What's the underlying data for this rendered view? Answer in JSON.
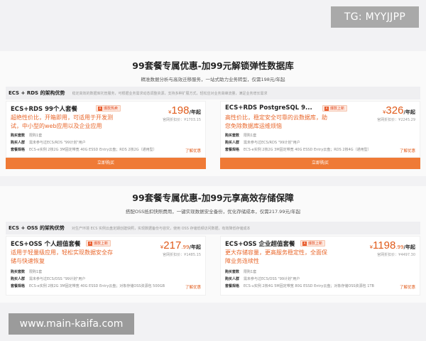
{
  "watermark_top": "TG: MYYJJPP",
  "watermark_bottom": "www.main-kaifa.com",
  "section1": {
    "headline": "99套餐专属优惠-加99元解锁弹性数据库",
    "subline": "精准数据分析与高效迁移服务，一站式助力业务转型，仅需198元/年起",
    "arch_title": "ECS + RDS 的架构优势",
    "arch_desc": "稳定高效的数据库托管服务，可根据业务需求动态调整资源，支持多种扩展方式，轻松应对业务高峰流量，满足业务增长需求",
    "cards": [
      {
        "name": "ECS+RDS 99个人套餐",
        "badge": "爆款热卖",
        "desc": "超绝性价比，开箱即用，可适用于开发测试，中小型的web应用以及企业应用",
        "price_symbol": "¥",
        "price": "198",
        "price_unit": "/年起",
        "orig_price": "官网折扣价：¥1703.15",
        "spec_rows": [
          {
            "label": "购买套数",
            "value": "限购1套"
          },
          {
            "label": "购买人群",
            "value": "需未参与过ECS/RDS \"99计划\"用户"
          },
          {
            "label": "套餐规格",
            "value": "ECS-e实例 2核2G 3M固定带宽 40G ESSD Entry云盘；RDS 2核2G（通用型）"
          }
        ],
        "more": "了解优惠",
        "buy": "立即购买"
      },
      {
        "name": "ECS+RDS PostgreSQL 9...",
        "badge": "爆款上新",
        "desc": "高性价比，稳定安全可靠的云数据库，助您免除数据库运维烦恼",
        "price_symbol": "¥",
        "price": "326",
        "price_unit": "/年起",
        "orig_price": "官网折扣价：¥2245.29",
        "spec_rows": [
          {
            "label": "购买套数",
            "value": "限购1套"
          },
          {
            "label": "购买人群",
            "value": "需未参与过ECS/RDS \"99计划\"用户"
          },
          {
            "label": "套餐规格",
            "value": "ECS-e实例 2核2G 3M固定带宽 40G ESSD Entry云盘；RDS 2核4G（通用型）"
          }
        ],
        "more": "了解优惠",
        "buy": "立即购买"
      }
    ]
  },
  "section2": {
    "headline": "99套餐专属优惠-加99元享高效存储保障",
    "subline": "搭配OSS抵扣快照费用，一键实现数据安全备份，优化存储成本，仅需217.99元/年起",
    "arch_title": "ECS + OSS 的架构优势",
    "arch_desc": "对生产环境 ECS 实例云盘定期创建快照，实现数据备份与容灾，使用 OSS 存储低频访问数据，有效降低存储成本",
    "cards": [
      {
        "name": "ECS+OSS 个人超值套餐",
        "badge": "爆款上新",
        "desc": "适用于轻量级应用，轻松实现数据安全存储与快速恢复",
        "price_symbol": "¥",
        "price": "217",
        "price_dec": ".99",
        "price_unit": "/年起",
        "orig_price": "官网折扣价：¥1485.15",
        "spec_rows": [
          {
            "label": "购买套数",
            "value": "限购1套"
          },
          {
            "label": "购买人群",
            "value": "需未参与过ECS/OSS \"99计划\"用户"
          },
          {
            "label": "套餐规格",
            "value": "ECS-e实例 2核2G 3M固定带宽 40G ESSD Entry云盘；对象存储OSS资源包 500GB"
          }
        ],
        "more": "了解优惠"
      },
      {
        "name": "ECS+OSS 企业超值套餐",
        "badge": "爆款上新",
        "desc": "更大存储容量，更高服务稳定性，全面保障业务连续性",
        "price_symbol": "¥",
        "price": "1198",
        "price_dec": ".99",
        "price_unit": "/年起",
        "orig_price": "官网折扣价：¥4497.30",
        "spec_rows": [
          {
            "label": "购买套数",
            "value": "限购1套"
          },
          {
            "label": "购买人群",
            "value": "需未参与过ECS/OSS \"99计划\"用户"
          },
          {
            "label": "套餐规格",
            "value": "ECS-u实例 2核4G 5M固定带宽 80G ESSD Entry云盘；对象存储OSS资源包 1TB"
          }
        ],
        "more": "了解优惠"
      }
    ]
  }
}
